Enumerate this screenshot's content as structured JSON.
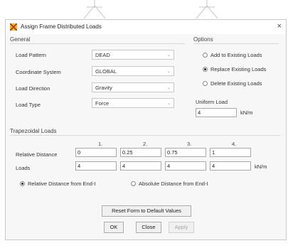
{
  "dialog": {
    "title": "Assign Frame Distributed Loads",
    "close_glyph": "×"
  },
  "general": {
    "heading": "General",
    "load_pattern": {
      "label": "Load Pattern",
      "value": "DEAD"
    },
    "coordinate_system": {
      "label": "Coordinate System",
      "value": "GLOBAL"
    },
    "load_direction": {
      "label": "Load Direction",
      "value": "Gravity"
    },
    "load_type": {
      "label": "Load Type",
      "value": "Force"
    }
  },
  "options": {
    "heading": "Options",
    "items": [
      {
        "label": "Add to Existing Loads",
        "selected": false
      },
      {
        "label": "Replace Existing Loads",
        "selected": true
      },
      {
        "label": "Delete Existing Loads",
        "selected": false
      }
    ]
  },
  "uniform": {
    "label": "Uniform Load",
    "value": "4",
    "unit": "kN/m"
  },
  "trapezoidal": {
    "heading": "Trapezoidal Loads",
    "columns": [
      "1.",
      "2.",
      "3.",
      "4."
    ],
    "relative_distance_label": "Relative Distance",
    "relative_distance": [
      "0",
      "0.25",
      "0.75",
      "1"
    ],
    "loads_label": "Loads",
    "loads": [
      "4",
      "4",
      "4",
      "4"
    ],
    "loads_unit": "kN/m",
    "distance_mode": [
      {
        "label": "Relative Distance from End-I",
        "selected": true
      },
      {
        "label": "Absolute Distance from End-I",
        "selected": false
      }
    ]
  },
  "buttons": {
    "reset": "Reset Form to Default Values",
    "ok": "OK",
    "close": "Close",
    "apply": "Apply"
  },
  "colors": {
    "icon": "#c0392b",
    "accent": "#333333"
  },
  "icons": {
    "title": "app-icon",
    "close": "close-icon",
    "combo": "chevron-down-icon"
  }
}
